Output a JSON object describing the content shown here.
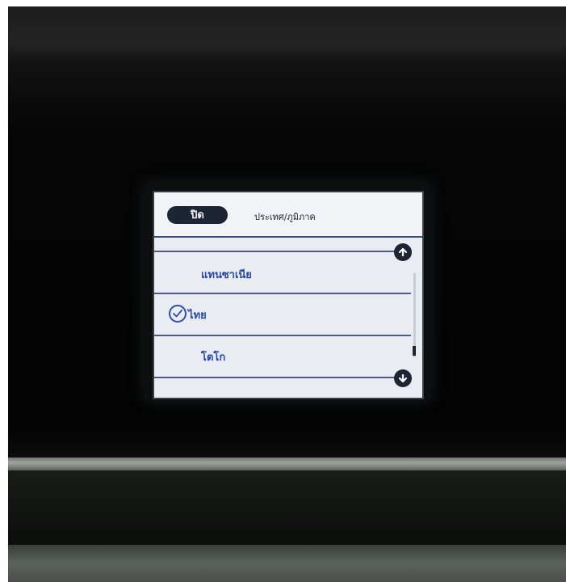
{
  "header": {
    "close_label": "ปิด",
    "title": "ประเทศ/ภูมิภาค"
  },
  "list": {
    "items": [
      {
        "label": "แทนซาเนีย",
        "selected": false
      },
      {
        "label": "ไทย",
        "selected": true
      },
      {
        "label": "โตโก",
        "selected": false
      }
    ]
  },
  "icons": {
    "scroll_up": "arrow-up-icon",
    "scroll_down": "arrow-down-icon",
    "selected": "checkmark-icon"
  },
  "colors": {
    "accent": "#2747a6",
    "button": "#1d2434",
    "screen": "#e9edf1"
  }
}
